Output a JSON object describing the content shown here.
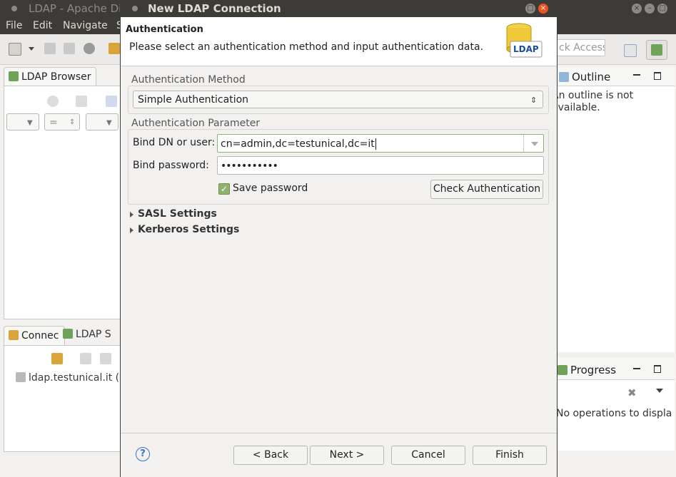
{
  "main_window": {
    "title": "LDAP - Apache Dir",
    "menu": [
      "File",
      "Edit",
      "Navigate",
      "S"
    ],
    "quick_access_placeholder": "ck Access",
    "ldap_browser_tab": "LDAP Browser",
    "filter_equals": "=",
    "connections_tab": "Connec",
    "ldap_servers_tab": "LDAP S",
    "connection_item": "ldap.testunical.it (",
    "outline_tab": "Outline",
    "outline_msg": "An outline is not available.",
    "progress_tab": "Progress",
    "progress_msg": "No operations to displa"
  },
  "dialog": {
    "title": "New LDAP Connection",
    "header_title": "Authentication",
    "header_description": "Please select an authentication method and input authentication data.",
    "header_icon_label": "LDAP",
    "auth_method_group": "Authentication Method",
    "auth_method_value": "Simple Authentication",
    "auth_param_group": "Authentication Parameter",
    "bind_dn_label": "Bind DN or user:",
    "bind_dn_value": "cn=admin,dc=testunical,dc=it",
    "bind_password_label": "Bind password:",
    "bind_password_value": "•••••••••••",
    "save_password_label": "Save password",
    "save_password_checked": true,
    "check_auth_button": "Check Authentication",
    "sasl_section": "SASL Settings",
    "kerberos_section": "Kerberos Settings",
    "help_button": "?",
    "back_button": "< Back",
    "next_button": "Next >",
    "cancel_button": "Cancel",
    "finish_button": "Finish"
  },
  "colors": {
    "titlebar": "#3c3b37",
    "focus_border": "#8ab56e",
    "help_blue": "#3b74c0"
  }
}
